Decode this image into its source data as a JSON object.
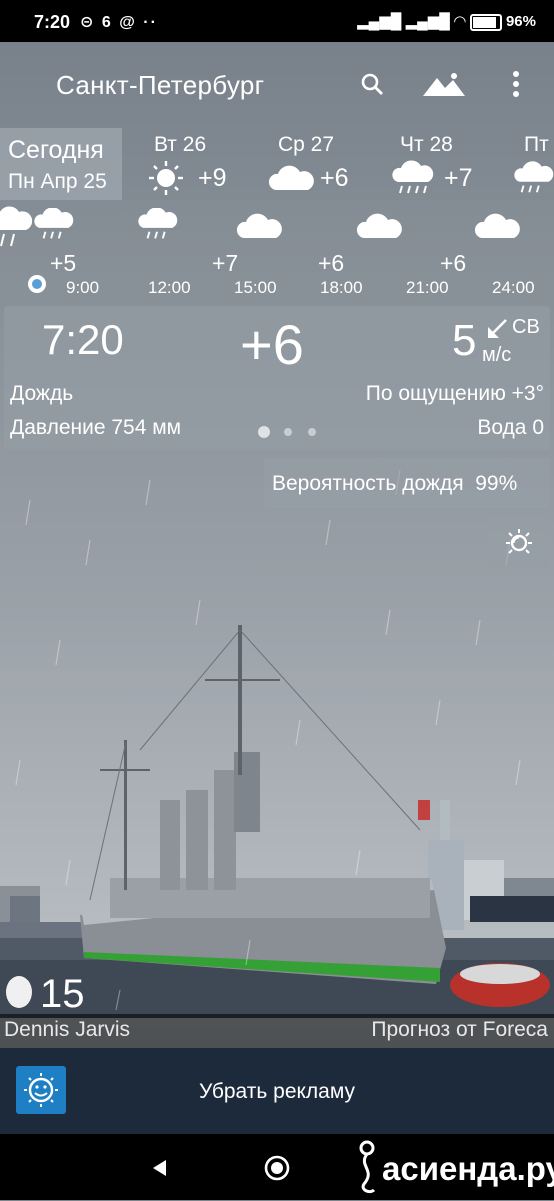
{
  "status_bar": {
    "time": "7:20",
    "left_icons_text": "⊝ 6 @ ··",
    "battery": "96"
  },
  "header": {
    "city": "Санкт-Петербург"
  },
  "days": {
    "today_label": "Сегодня",
    "today_date": "Пн Апр 25",
    "items": [
      {
        "name": "Вт 26",
        "temp": "+9",
        "icon": "sun-icon"
      },
      {
        "name": "Ср 27",
        "temp": "+6",
        "icon": "cloud-icon"
      },
      {
        "name": "Чт 28",
        "temp": "+7",
        "icon": "rain-cloud-icon"
      },
      {
        "name": "Пт",
        "temp": "",
        "icon": "rain-cloud-icon"
      }
    ]
  },
  "hourly": {
    "temps": [
      "+5",
      "+7",
      "+6",
      "+6"
    ],
    "times": [
      "9:00",
      "12:00",
      "15:00",
      "18:00",
      "21:00",
      "24:00"
    ]
  },
  "current": {
    "time": "7:20",
    "temp": "+6",
    "wind_speed": "5",
    "wind_dir": "СВ",
    "wind_unit": "м/с",
    "condition": "Дождь",
    "feels_like": "По ощущению +3°",
    "pressure": "Давление 754 мм",
    "water": "Вода 0"
  },
  "rain_probability": "Вероятность дождя  99%",
  "moon_day": "15",
  "credits": {
    "photo": "Dennis Jarvis",
    "forecast": "Прогноз от Foreca"
  },
  "ad": {
    "label": "Убрать рекламу"
  },
  "watermark": "асиенда.ру",
  "colors": {
    "sky": "#8a9199",
    "panel": "#969ea6",
    "ad_bar": "#1d2a3b",
    "ad_icon": "#1f7fc4",
    "ship_hull": "#8d9297",
    "ship_stripe": "#3aa33a"
  }
}
